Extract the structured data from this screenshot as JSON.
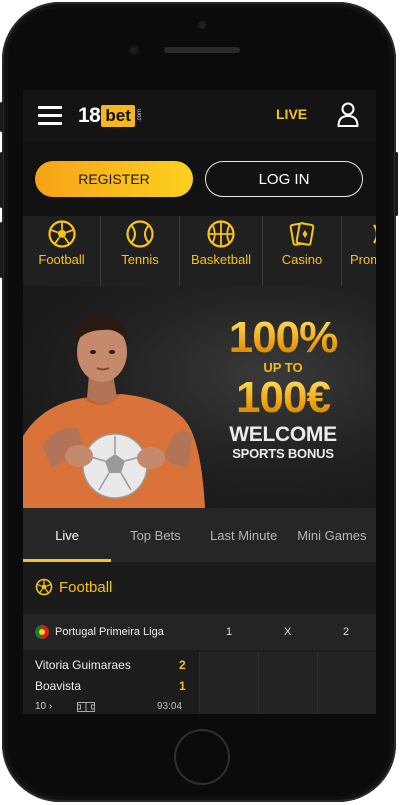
{
  "header": {
    "logo_number": "18",
    "logo_word": "bet",
    "logo_suffix": ".com",
    "live_label": "LIVE",
    "menu_icon": "hamburger-icon",
    "user_icon": "user-icon"
  },
  "auth": {
    "register_label": "REGISTER",
    "login_label": "LOG IN"
  },
  "sports_nav": [
    {
      "label": "Football",
      "icon": "soccer-ball-icon"
    },
    {
      "label": "Tennis",
      "icon": "tennis-ball-icon"
    },
    {
      "label": "Basketball",
      "icon": "basketball-icon"
    },
    {
      "label": "Casino",
      "icon": "cards-icon"
    },
    {
      "label": "Prom",
      "icon": "promo-icon"
    }
  ],
  "banner": {
    "line1": "100%",
    "line2": "UP TO",
    "line3": "100€",
    "line4": "WELCOME",
    "line5": "SPORTS BONUS"
  },
  "tabs": [
    {
      "label": "Live",
      "active": true
    },
    {
      "label": "Top Bets",
      "active": false
    },
    {
      "label": "Last Minute",
      "active": false
    },
    {
      "label": "Mini Games",
      "active": false
    }
  ],
  "section": {
    "title": "Football",
    "icon": "soccer-ball-icon"
  },
  "league": {
    "name": "Portugal Primeira Liga",
    "odds_headers": [
      "1",
      "X",
      "2"
    ]
  },
  "match": {
    "home_team": "Vitoria Guimaraes",
    "away_team": "Boavista",
    "home_score": "2",
    "away_score": "1",
    "markets_count": "10",
    "time": "93:04"
  },
  "colors": {
    "accent": "#f7c21c",
    "background": "#1b1b1b",
    "header": "#141414"
  }
}
